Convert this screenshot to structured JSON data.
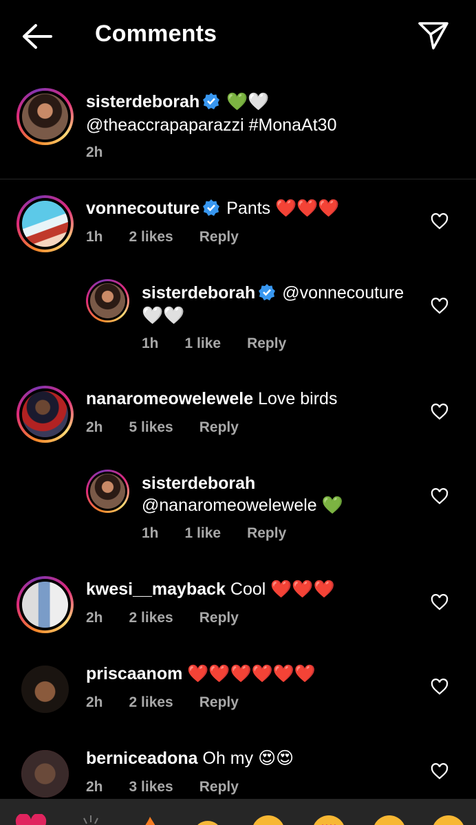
{
  "header": {
    "title": "Comments",
    "back_icon": "back-arrow-icon",
    "send_icon": "send-icon"
  },
  "caption": {
    "username": "sisterdeborah",
    "emojis": "💚🤍",
    "text": "@theaccrapaparazzi #MonaAt30",
    "time": "2h"
  },
  "comments": [
    {
      "username": "vonnecouture",
      "verified": true,
      "text": "Pants",
      "emojis": "❤️❤️❤️",
      "time": "1h",
      "likes": "2 likes",
      "reply": "Reply"
    },
    {
      "username": "sisterdeborah",
      "verified": true,
      "text": "@vonnecouture",
      "emojis": "🤍🤍",
      "time": "1h",
      "likes": "1 like",
      "reply": "Reply",
      "is_reply": true
    },
    {
      "username": "nanaromeowelewele",
      "verified": false,
      "text": "Love birds",
      "time": "2h",
      "likes": "5 likes",
      "reply": "Reply"
    },
    {
      "username": "sisterdeborah",
      "verified": false,
      "text": "@nanaromeowelewele",
      "emojis": "💚",
      "time": "1h",
      "likes": "1 like",
      "reply": "Reply",
      "is_reply": true
    },
    {
      "username": "kwesi__mayback",
      "verified": false,
      "text": "Cool",
      "emojis": "❤️❤️❤️",
      "time": "2h",
      "likes": "2 likes",
      "reply": "Reply"
    },
    {
      "username": "priscaanom",
      "verified": false,
      "text": "",
      "emojis": "❤️❤️❤️❤️❤️❤️",
      "time": "2h",
      "likes": "2 likes",
      "reply": "Reply"
    },
    {
      "username": "berniceadona",
      "verified": false,
      "text": "Oh my",
      "emojis": "😍😍",
      "time": "2h",
      "likes": "3 likes",
      "reply": "Reply"
    }
  ],
  "colors": {
    "verified_blue": "#3897f0",
    "muted": "#a8a8a8",
    "heart_red": "#e0245e"
  }
}
